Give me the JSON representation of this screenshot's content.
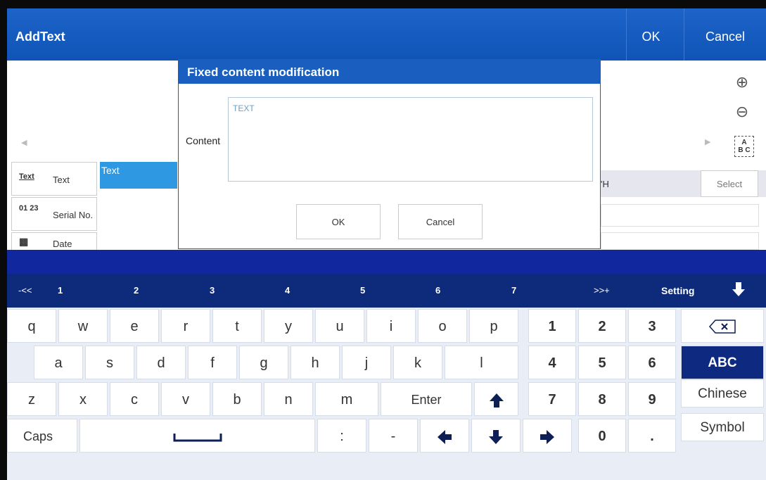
{
  "title_bar": {
    "title": "AddText",
    "ok": "OK",
    "cancel": "Cancel"
  },
  "left_panel": {
    "types": [
      {
        "icon_text": "Text",
        "label": "Text"
      },
      {
        "icon_text": "01 23",
        "label": "Serial No."
      },
      {
        "icon_text": "▦",
        "label": "Date"
      }
    ],
    "selected": "Text"
  },
  "right_panel": {
    "partial_label": "'H",
    "select": "Select"
  },
  "dialog": {
    "title": "Fixed content modification",
    "content_label": "Content",
    "content_value": "TEXT",
    "ok": "OK",
    "cancel": "Cancel"
  },
  "keyboard": {
    "header": {
      "prev": "-<<",
      "pages": [
        "1",
        "2",
        "3",
        "4",
        "5",
        "6",
        "7"
      ],
      "next": ">>+",
      "setting": "Setting"
    },
    "row1": [
      "q",
      "w",
      "e",
      "r",
      "t",
      "y",
      "u",
      "i",
      "o",
      "p"
    ],
    "row2": [
      "a",
      "s",
      "d",
      "f",
      "g",
      "h",
      "j",
      "k",
      "l"
    ],
    "row3": [
      "z",
      "x",
      "c",
      "v",
      "b",
      "n",
      "m"
    ],
    "enter": "Enter",
    "caps": "Caps",
    "colon": ":",
    "dash": "-",
    "numpad": [
      "1",
      "2",
      "3",
      "4",
      "5",
      "6",
      "7",
      "8",
      "9",
      "0",
      "."
    ],
    "modes": {
      "backspace": "⌫",
      "abc": "ABC",
      "chinese": "Chinese",
      "symbol": "Symbol"
    }
  }
}
